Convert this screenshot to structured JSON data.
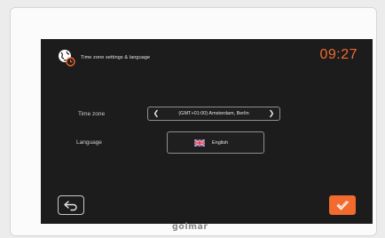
{
  "header": {
    "icon": "globe-clock-icon",
    "title": "Time zone settings & language",
    "clock": "09:27"
  },
  "timezone": {
    "label": "Time zone",
    "value": "(GMT+01:00) Amsterdam, Berlin",
    "prev_icon": "chevron-left-icon",
    "next_icon": "chevron-right-icon"
  },
  "language": {
    "label": "Language",
    "value": "English",
    "flag_icon": "uk-flag-icon"
  },
  "footer": {
    "back_icon": "back-arrow-icon",
    "confirm_icon": "checkmark-icon"
  },
  "device": {
    "brand": "golmar"
  },
  "colors": {
    "accent": "#f26a2e",
    "screen_bg": "#1c1c1c",
    "text": "#e6e6e6"
  }
}
